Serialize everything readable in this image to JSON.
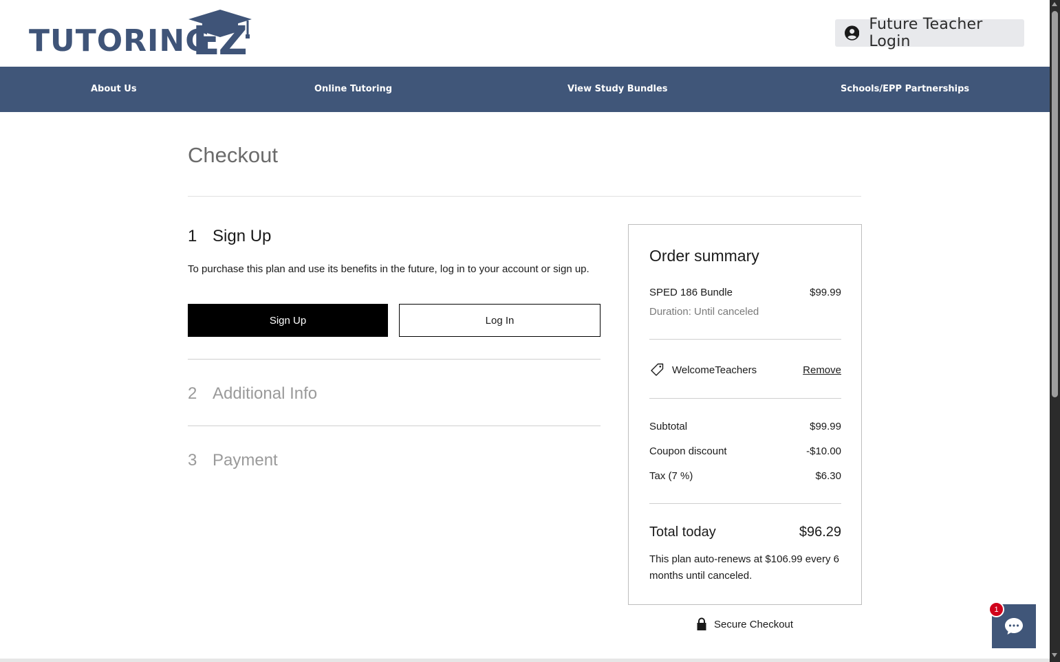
{
  "header": {
    "logo_text": "TUTORING",
    "logo_ez": "EZ",
    "login_label": "Future Teacher Login"
  },
  "nav": {
    "items": [
      {
        "label": "About Us"
      },
      {
        "label": "Online Tutoring"
      },
      {
        "label": "View Study Bundles"
      },
      {
        "label": "Schools/EPP Partnerships"
      }
    ]
  },
  "checkout": {
    "title": "Checkout",
    "steps": [
      {
        "num": "1",
        "title": "Sign Up"
      },
      {
        "num": "2",
        "title": "Additional Info"
      },
      {
        "num": "3",
        "title": "Payment"
      }
    ],
    "signup_description": "To purchase this plan and use its benefits in the future, log in to your account or sign up.",
    "signup_button": "Sign Up",
    "login_button": "Log In"
  },
  "summary": {
    "title": "Order summary",
    "item_name": "SPED 186 Bundle",
    "item_price": "$99.99",
    "duration": "Duration: Until canceled",
    "coupon_code": "WelcomeTeachers",
    "coupon_remove": "Remove",
    "subtotal_label": "Subtotal",
    "subtotal_value": "$99.99",
    "discount_label": "Coupon discount",
    "discount_value": "-$10.00",
    "tax_label": "Tax (7 %)",
    "tax_value": "$6.30",
    "total_label": "Total today",
    "total_value": "$96.29",
    "renew_note": "This plan auto-renews at $106.99 every 6 months until canceled."
  },
  "secure_checkout": "Secure Checkout",
  "chat": {
    "badge_count": "1"
  },
  "colors": {
    "brand_navy": "#405679",
    "button_black": "#000000",
    "badge_red": "#d0021b"
  },
  "icons": [
    "user-circle-icon",
    "graduation-cap-icon",
    "tag-icon",
    "lock-icon",
    "chat-bubble-icon"
  ]
}
